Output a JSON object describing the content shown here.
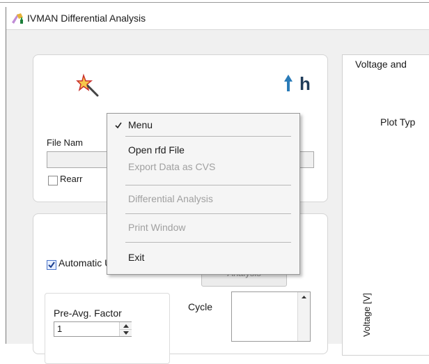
{
  "window": {
    "title": "IVMAN Differential Analysis"
  },
  "file_panel": {
    "file_name_label": "File Nam",
    "rearrange_label": "Rearr",
    "logo_partial": "h"
  },
  "controls": {
    "automatic_update_label": "Automatic Update",
    "automatic_update_checked": true,
    "differential_button_label": "Differential Analysis",
    "pre_avg_label": "Pre-Avg. Factor",
    "pre_avg_value": "1",
    "cycle_label": "Cycle"
  },
  "right_pane": {
    "tab_label": "Voltage and",
    "plot_type_label": "Plot Typ",
    "y_axis_label": "Voltage [V]"
  },
  "context_menu": {
    "items": [
      {
        "label": "Menu",
        "checked": true,
        "enabled": true
      },
      {
        "label": "Open rfd File",
        "enabled": true
      },
      {
        "label": "Export Data as CVS",
        "enabled": false
      },
      {
        "label": "Differential Analysis",
        "enabled": false
      },
      {
        "label": "Print Window",
        "enabled": false
      },
      {
        "label": "Exit",
        "enabled": true
      }
    ]
  },
  "colors": {
    "checkbox_accent": "#4a74c9",
    "disabled_text": "#a0a0a0"
  }
}
